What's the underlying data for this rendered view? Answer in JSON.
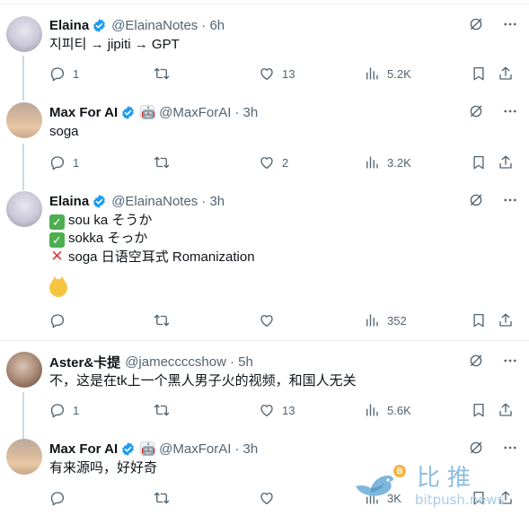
{
  "tweets": [
    {
      "author": "Elaina",
      "handle": "@ElainaNotes",
      "time": "· 6h",
      "lines": [
        "지피티 → jipiti → GPT"
      ],
      "stats": {
        "replies": "1",
        "retweets": "",
        "likes": "13",
        "views": "5.2K"
      }
    },
    {
      "author": "Max For AI",
      "handle": "@MaxForAI",
      "time": "· 3h",
      "lines": [
        "soga"
      ],
      "stats": {
        "replies": "1",
        "retweets": "",
        "likes": "2",
        "views": "3.2K"
      }
    },
    {
      "author": "Elaina",
      "handle": "@ElainaNotes",
      "time": "· 3h",
      "lines": [
        "sou ka そうか",
        "sokka そっか",
        "soga 日语空耳式 Romanization"
      ],
      "stats": {
        "replies": "",
        "retweets": "",
        "likes": "",
        "views": "352"
      }
    },
    {
      "author": "Aster&卡提",
      "handle": "@jameccccshow",
      "time": "· 5h",
      "lines": [
        "不，这是在tk上一个黑人男子火的视频，和国人无关"
      ],
      "stats": {
        "replies": "1",
        "retweets": "",
        "likes": "13",
        "views": "5.6K"
      }
    },
    {
      "author": "Max For AI",
      "handle": "@MaxForAI",
      "time": "· 3h",
      "lines": [
        "有来源吗，好好奇"
      ],
      "stats": {
        "replies": "",
        "retweets": "",
        "likes": "",
        "views": "3K"
      }
    }
  ],
  "watermark": {
    "cn": "比推",
    "en": "bitpush.news",
    "coin": "B"
  },
  "colors": {
    "verified": "#1d9bf0",
    "muted": "#536471",
    "text": "#0f1419"
  }
}
